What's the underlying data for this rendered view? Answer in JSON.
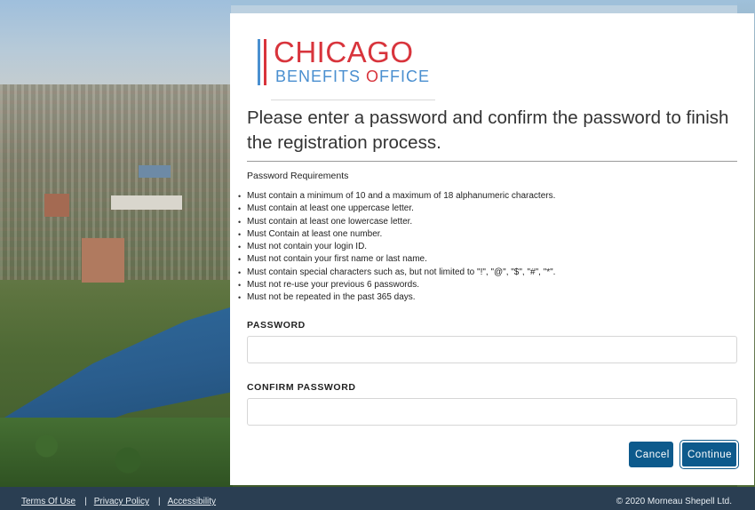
{
  "logo": {
    "line1": "CHICAGO",
    "line2_prefix": "BENEFITS ",
    "line2_o": "O",
    "line2_suffix": "FFICE",
    "accent_red": "#d8343c",
    "accent_blue": "#4a8fd0"
  },
  "heading": "Please enter a password and confirm the password to finish the registration process.",
  "requirements": {
    "title": "Password Requirements",
    "items": [
      "Must contain a minimum of 10 and a maximum of 18 alphanumeric characters.",
      "Must contain at least one uppercase letter.",
      "Must contain at least one lowercase letter.",
      "Must Contain at least one number.",
      "Must not contain your login ID.",
      "Must not contain your first name or last name.",
      "Must contain special characters such as, but not limited to \"!\", \"@\", \"$\", \"#\", \"*\".",
      "Must not re-use your previous 6 passwords.",
      "Must not be repeated in the past 365 days."
    ]
  },
  "form": {
    "password_label": "PASSWORD",
    "password_value": "",
    "confirm_label": "CONFIRM PASSWORD",
    "confirm_value": ""
  },
  "buttons": {
    "cancel": "Cancel",
    "continue": "Continue",
    "color": "#0d5a8c"
  },
  "footer": {
    "terms": "Terms Of Use",
    "privacy": "Privacy Policy",
    "accessibility": "Accessibility",
    "separator": "|",
    "copyright": "© 2020 Morneau Shepell Ltd."
  }
}
